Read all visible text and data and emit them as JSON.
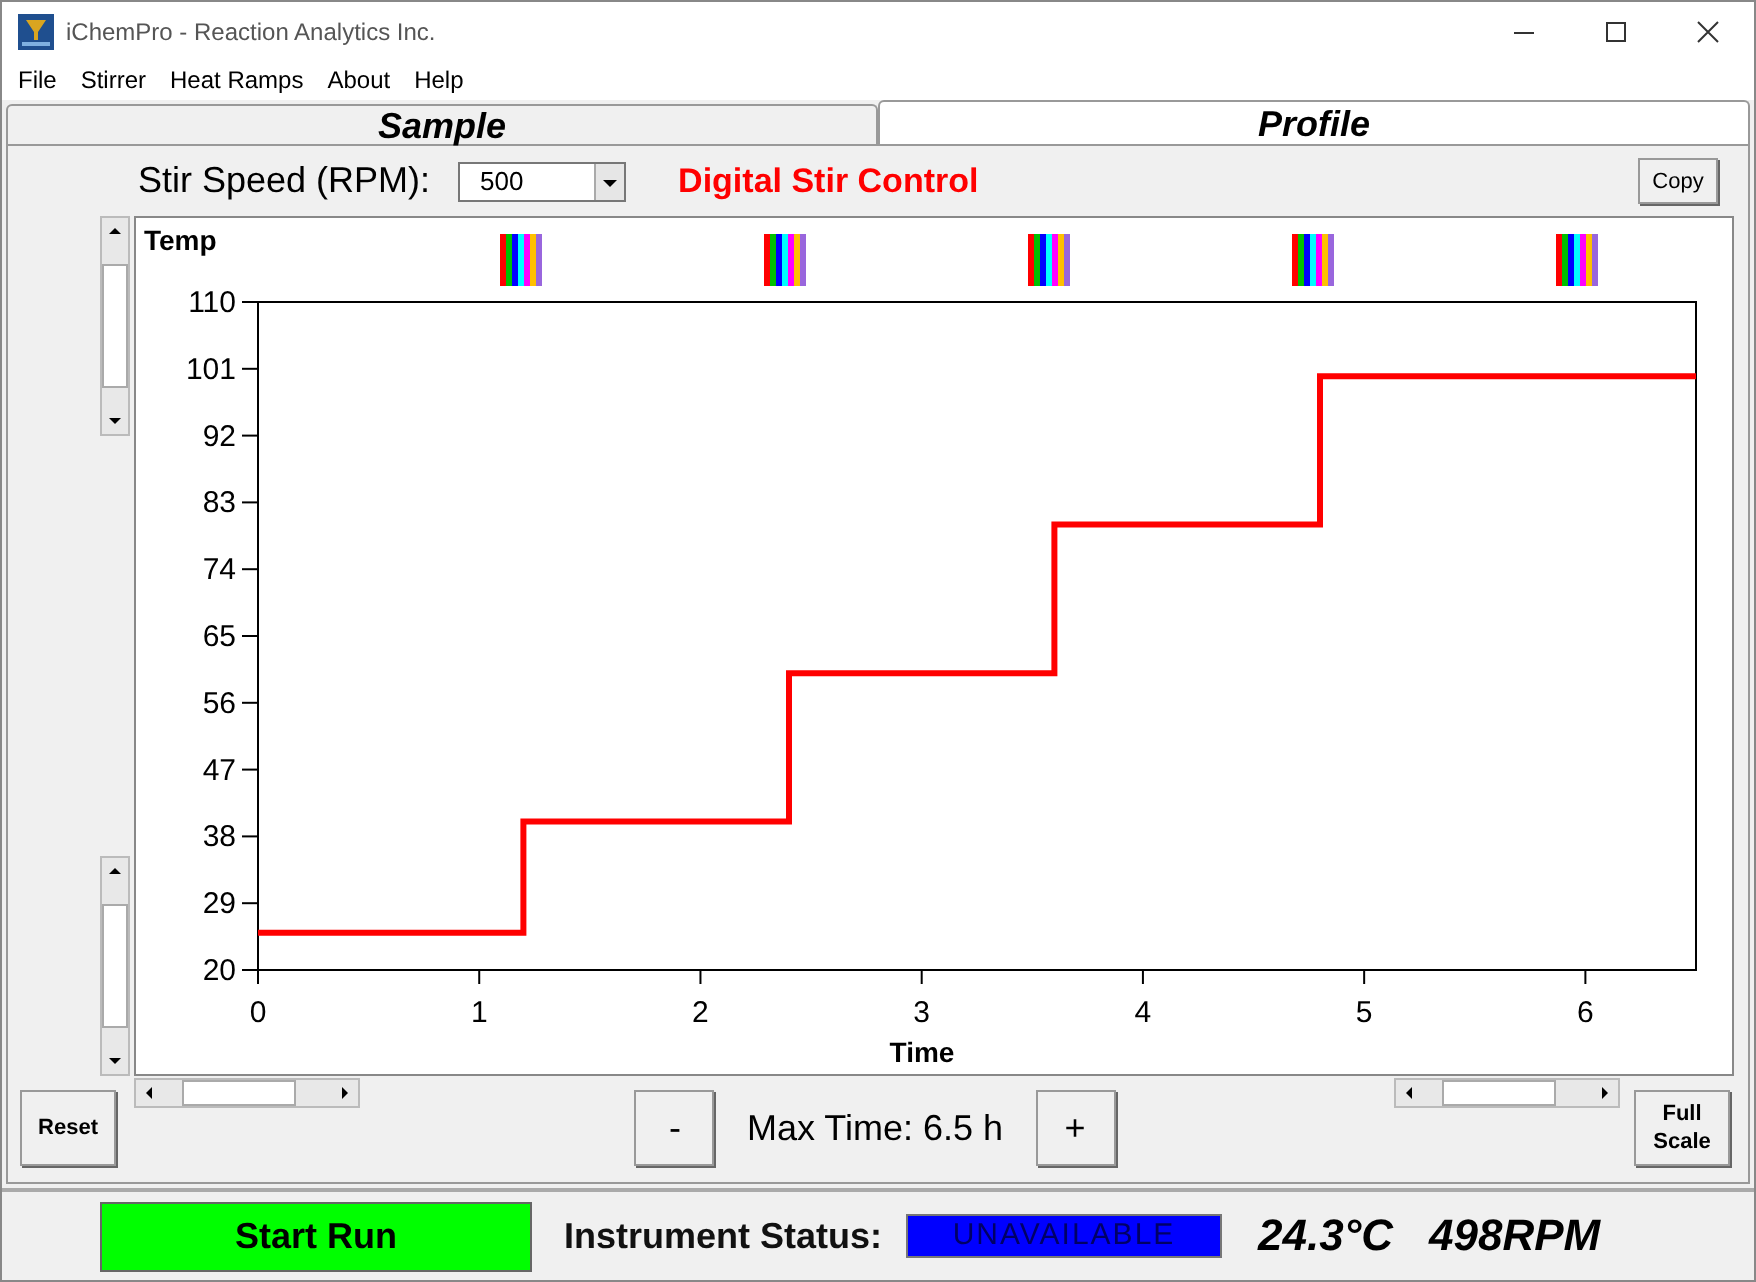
{
  "window": {
    "title": "iChemPro - Reaction Analytics Inc."
  },
  "menu": [
    "File",
    "Stirrer",
    "Heat Ramps",
    "About",
    "Help"
  ],
  "tabs": [
    {
      "label": "Sample",
      "selected": false
    },
    {
      "label": "Profile",
      "selected": true
    }
  ],
  "stir_speed": {
    "label": "Stir Speed (RPM):",
    "value": "500"
  },
  "mode_label": "Digital Stir Control",
  "copy_button": "Copy",
  "chart": {
    "chart_data": {
      "type": "line",
      "xlabel": "Time",
      "ylabel": "Temp",
      "x": [
        0,
        1.2,
        1.2,
        2.4,
        2.4,
        3.6,
        3.6,
        4.8,
        4.8,
        6.5
      ],
      "series": [
        {
          "color": "#ff0000",
          "values": [
            25,
            25,
            40,
            40,
            60,
            60,
            80,
            80,
            100,
            100
          ]
        }
      ],
      "xlim": [
        0,
        6.5
      ],
      "ylim": [
        20,
        110
      ],
      "xticks": [
        0,
        1,
        2,
        3,
        4,
        5,
        6
      ],
      "yticks": [
        20,
        29,
        38,
        47,
        56,
        65,
        74,
        83,
        92,
        101,
        110
      ]
    }
  },
  "reset_button": "Reset",
  "minus_button": "-",
  "max_time": "Max Time: 6.5 h",
  "plus_button": "+",
  "full_scale_button": "Full Scale",
  "start_button": "Start Run",
  "status_label": "Instrument Status:",
  "status_value": "UNAVAILABLE",
  "temperature": "24.3°C",
  "rpm": "498RPM"
}
